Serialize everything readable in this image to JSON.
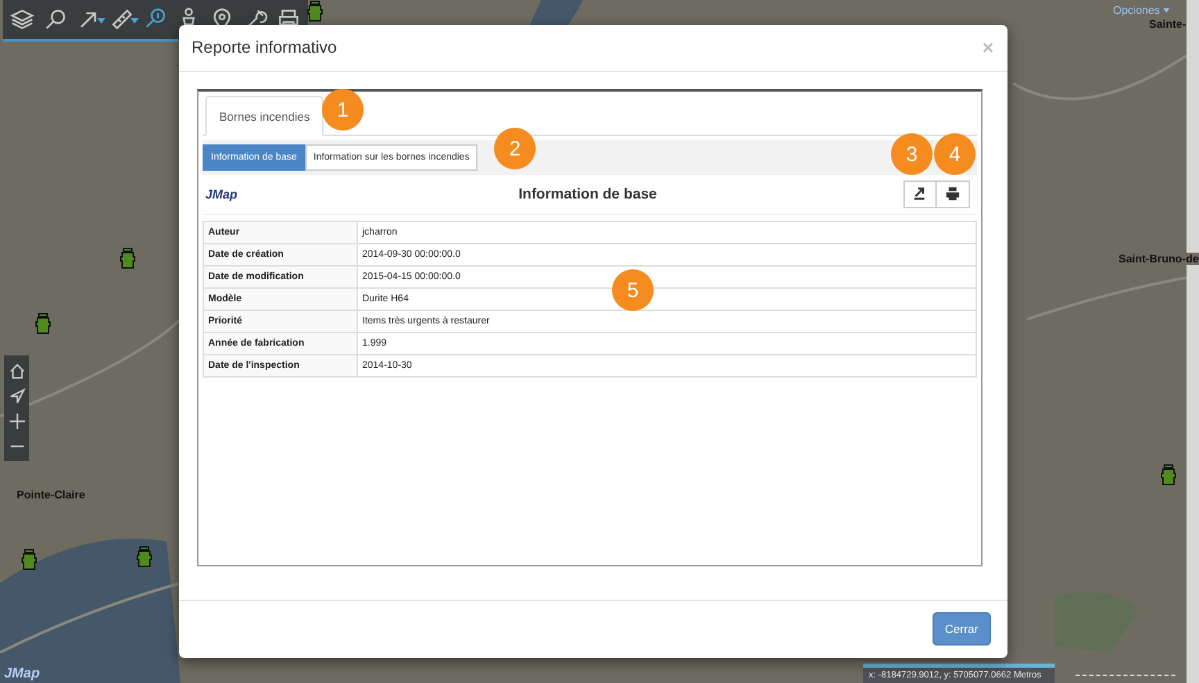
{
  "map": {
    "labels": [
      {
        "text": "Pointe-Claire"
      },
      {
        "text": "Saint-Bruno-de"
      },
      {
        "text": "Sainte-"
      }
    ],
    "options_menu": "Opciones",
    "logo": "JMap",
    "coordinates": "x: -8184729.9012, y: 5705077.0662 Metros"
  },
  "toolbar": [
    {
      "kind": "layers",
      "selected": false,
      "dropdown": false
    },
    {
      "kind": "search",
      "selected": false,
      "dropdown": false
    },
    {
      "kind": "arrow",
      "selected": false,
      "dropdown": true
    },
    {
      "kind": "ruler",
      "selected": false,
      "dropdown": true
    },
    {
      "kind": "info",
      "selected": true,
      "dropdown": false
    },
    {
      "kind": "person",
      "selected": false,
      "dropdown": false
    },
    {
      "kind": "pin",
      "selected": false,
      "dropdown": false
    },
    {
      "kind": "wrench",
      "selected": false,
      "dropdown": false
    },
    {
      "kind": "print",
      "selected": false,
      "dropdown": false
    }
  ],
  "nav_controls": [
    {
      "kind": "home"
    },
    {
      "kind": "navigate"
    },
    {
      "kind": "plus"
    },
    {
      "kind": "minus"
    }
  ],
  "dialog": {
    "title": "Reporte informativo",
    "close": "×",
    "tabs": [
      {
        "label": "Bornes incendies",
        "selected": true
      }
    ],
    "subtabs": [
      {
        "label": "Information de base",
        "selected": true
      },
      {
        "label": "Information sur les bornes incendies",
        "selected": false
      }
    ],
    "logo": "JMap",
    "heading": "Information de base",
    "actions": [
      {
        "kind": "export"
      },
      {
        "kind": "print"
      }
    ],
    "rows": [
      {
        "label": "Auteur",
        "value": "jcharron"
      },
      {
        "label": "Date de création",
        "value": "2014-09-30 00:00:00.0"
      },
      {
        "label": "Date de modification",
        "value": "2015-04-15 00:00:00.0"
      },
      {
        "label": "Modèle",
        "value": "Durite H64"
      },
      {
        "label": "Priorité",
        "value": "Items très urgents à restaurer"
      },
      {
        "label": "Année de fabrication",
        "value": "1.999"
      },
      {
        "label": "Date de l'inspection",
        "value": "2014-10-30"
      }
    ],
    "button": "Cerrar"
  },
  "callouts": [
    "1",
    "2",
    "3",
    "4",
    "5"
  ]
}
